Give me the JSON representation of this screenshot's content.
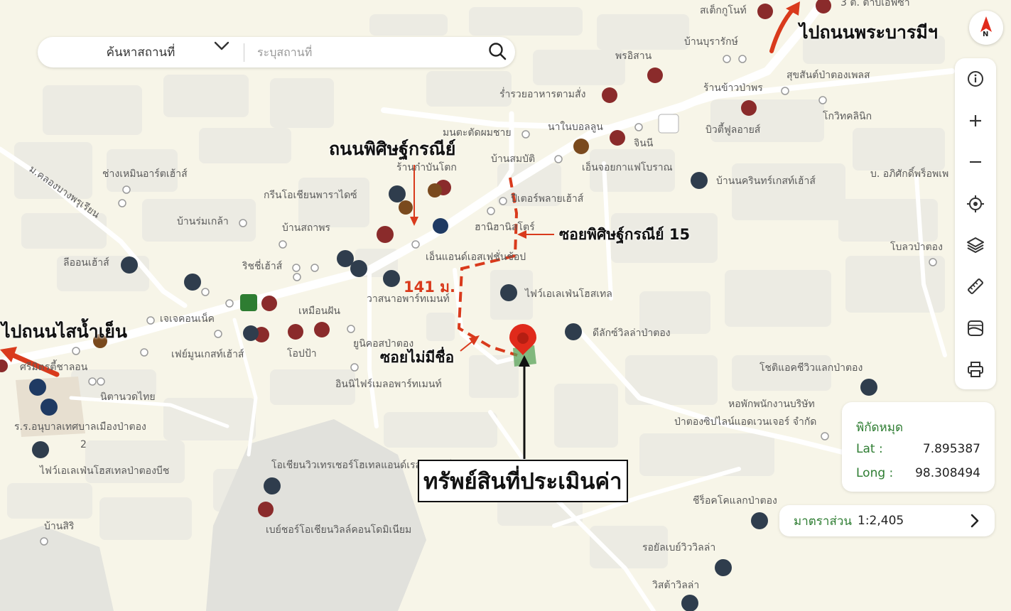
{
  "search": {
    "category_label": "ค้นหาสถานที่",
    "placeholder": "ระบุสถานที่"
  },
  "compass": {
    "label": "N"
  },
  "coordinates": {
    "title": "พิกัดหมุด",
    "lat_label": "Lat :",
    "lat_value": "7.895387",
    "long_label": "Long :",
    "long_value": "98.308494"
  },
  "scale": {
    "label": "มาตราส่วน",
    "value": "1:2,405"
  },
  "annotations": {
    "road_main": "ถนนพิศิษฐ์กรณีย์",
    "soi_15": "ซอยพิศิษฐ์กรณีย์ 15",
    "soi_unnamed": "ซอยไม่มีชื่อ",
    "distance": "141 ม.",
    "property": "ทรัพย์สินที่ประเมินค่า",
    "to_sai_nam_yen": "ไปถนนไสน้ำเย็น",
    "to_phra_barami": "ไปถนนพระบารมีฯ"
  },
  "colors": {
    "map_bg": "#f7f5e8",
    "block": "#ecebe3",
    "road": "#ffffff",
    "route": "#d93a1c",
    "pin": "#e02a1b",
    "parcel": "#5aa35a",
    "accent_green": "#2e7d32"
  },
  "poi_labels": [
    "สเต็กกูโนท์",
    "3 ต. ตาบเอฟซา",
    "บ้านบุรารักษ์",
    "พรอิสาน",
    "สุขสันต์ป่าตองเพลส",
    "ร้านข้าวป่าพร",
    "ร่ำรวยอาหารตามสั่ง",
    "มนตะตัดผมชาย",
    "นาในบอลลูน",
    "จินนี",
    "บิวตี้ฟูลอายส์",
    "โกวิทคลินิก",
    "ถนนบ้านสมบัติ",
    "เอ็นจอยกาแฟโบราณ",
    "บ้านนครินทร์เกสท์เฮ้าส์",
    "บ. อภิศักดิ์พร็อพเพ",
    "ช่างเหมินอาร์ตเฮ้าส์",
    "ร้านก๋าบันโตก",
    "กรีนโอเชียนพาราไดซ์",
    "บ้านสมบัติ",
    "ปีเตอร์พลายเฮ้าส์",
    "บ้านร่มเกล้า",
    "บ้านสถาพร",
    "ฮานิฮานิสโตร์",
    "เอ็นแอนด์เอสเฟชั่นช้อป",
    "โบลวป่าตอง",
    "ลีออนเฮ้าส์",
    "ริชชี่เฮ้าส์",
    "วาสนาอพาร์ทเมนท์",
    "ไฟว์เอเลเฟ่นโฮสเทล",
    "เหมือนฝัน",
    "เจเจคอนเน็ค",
    "ดีลักซ์วิลล่าป่าตอง",
    "ยูนิคอสป่าตอง",
    "เฟย์มูนเกสท์เฮ้าส์",
    "โอปป้า",
    "ศรีมิตรตี้ชาลอน",
    "นิตานวดไทย",
    "อินนิไฟร์เมลอพาร์ทเมนท์",
    "โชติแอคชีวิวแลกป่าตอง",
    "หอพักพนักงานบริษัท",
    "ป่าตองซิปไลน์แอดเวนเจอร์ จำกัด",
    "ร.ร.อนุบาลเทศบาลเมืองป่าตอง",
    "ไฟว์เอเลเฟ่นโฮสเทลป่าตองบีช",
    "โอเชียนวิวเทรเชอร์โฮเทลแอนด์เรสซิเดนซ์",
    "เบย์ชอร์โอเชียนวิลล์คอนโดมิเนียม",
    "บ้านสิริ",
    "ชีร็อคโคแลกป่าตอง",
    "รอยัลเบย์วิววิลล่า",
    "วิสต้าวิลล่า",
    "ม.คลองบางพรุเรียน",
    "2"
  ]
}
